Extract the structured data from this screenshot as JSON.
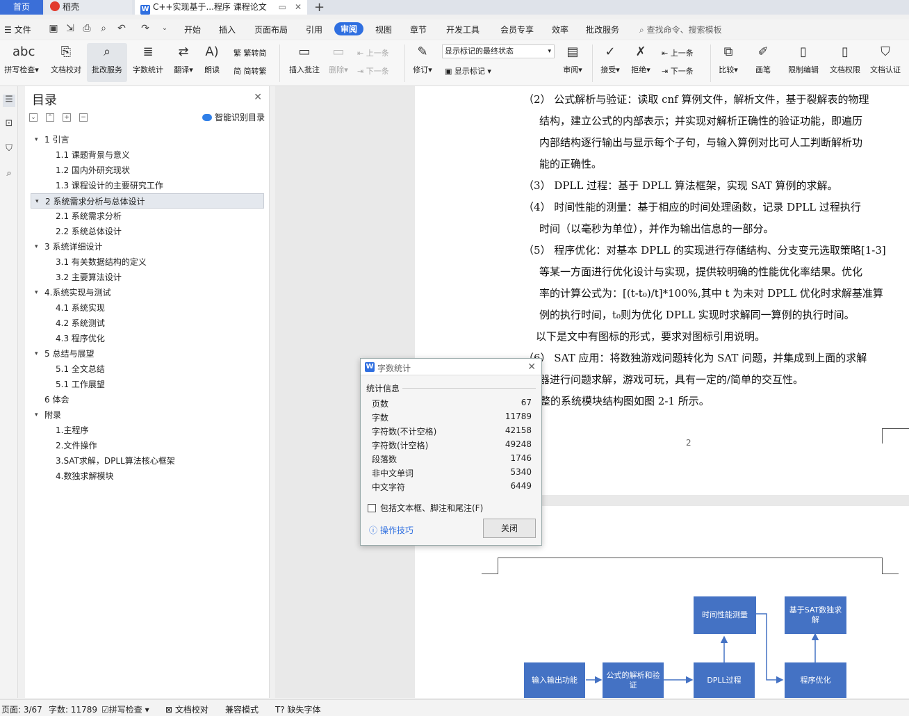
{
  "tabs": {
    "home": "首页",
    "wk": "稻壳",
    "doc": "C++实现基于...程序 课程论文"
  },
  "menu": {
    "file": "文件",
    "items": [
      "开始",
      "插入",
      "页面布局",
      "引用",
      "审阅",
      "视图",
      "章节",
      "开发工具",
      "会员专享",
      "效率",
      "批改服务"
    ],
    "active": "审阅",
    "search": "查找命令、搜索模板"
  },
  "ribbon": {
    "spell": "拼写检查",
    "proof": "文档校对",
    "review_service": "批改服务",
    "word_count": "字数统计",
    "translate": "翻译",
    "read": "朗读",
    "trad": "繁转简",
    "simp": "简转繁",
    "insert_comment": "插入批注",
    "delete": "删除",
    "prev": "上一条",
    "next": "下一条",
    "revise": "修订",
    "markup_state": "显示标记的最终状态",
    "show_markup": "显示标记",
    "review": "审阅",
    "accept": "接受",
    "reject": "拒绝",
    "prev2": "上一条",
    "next2": "下一条",
    "compare": "比较",
    "pen": "画笔",
    "restrict": "限制编辑",
    "perm": "文档权限",
    "auth": "文档认证"
  },
  "toc": {
    "title": "目录",
    "smart": "智能识别目录",
    "items": [
      {
        "text": "1 引言",
        "level": 1,
        "arrow": true
      },
      {
        "text": "1.1  课题背景与意义",
        "level": 2
      },
      {
        "text": "1.2  国内外研究现状",
        "level": 2
      },
      {
        "text": "1.3  课程设计的主要研究工作",
        "level": 2
      },
      {
        "text": "2  系统需求分析与总体设计",
        "level": 1,
        "arrow": true,
        "selected": true
      },
      {
        "text": "2.1    系统需求分析",
        "level": 2
      },
      {
        "text": "2.2  系统总体设计",
        "level": 2
      },
      {
        "text": "3  系统详细设计",
        "level": 1,
        "arrow": true
      },
      {
        "text": "3.1    有关数据结构的定义",
        "level": 2
      },
      {
        "text": "3.2    主要算法设计",
        "level": 2
      },
      {
        "text": "4.系统实现与测试",
        "level": 1,
        "arrow": true
      },
      {
        "text": "4.1  系统实现",
        "level": 2
      },
      {
        "text": "4.2  系统测试",
        "level": 2
      },
      {
        "text": "4.3 程序优化",
        "level": 2
      },
      {
        "text": "5  总结与展望",
        "level": 1,
        "arrow": true
      },
      {
        "text": "5.1  全文总结",
        "level": 2
      },
      {
        "text": "5.1  工作展望",
        "level": 2
      },
      {
        "text": "6 体会",
        "level": 1
      },
      {
        "text": "附录",
        "level": 1,
        "arrow": true
      },
      {
        "text": "1.主程序",
        "level": 2
      },
      {
        "text": "2.文件操作",
        "level": 2
      },
      {
        "text": "3.SAT求解，DPLL算法核心框架",
        "level": 2
      },
      {
        "text": "4.数独求解模块",
        "level": 2
      }
    ]
  },
  "doc": {
    "p2": [
      "（2）   公式解析与验证：读取 cnf 算例文件，解析文件，基于裂解表的物理",
      "结构，建立公式的内部表示；并实现对解析正确性的验证功能，即遍历",
      "内部结构逐行输出与显示每个子句，与输入算例对比可人工判断解析功",
      "能的正确性。"
    ],
    "p3": [
      "（3）   DPLL 过程：基于 DPLL 算法框架，实现 SAT 算例的求解。"
    ],
    "p4": [
      "（4）   时间性能的测量：基于相应的时间处理函数，记录 DPLL 过程执行",
      "时间（以毫秒为单位），并作为输出信息的一部分。"
    ],
    "p5": [
      "（5）   程序优化：对基本 DPLL 的实现进行存储结构、分支变元选取策略[1-3]",
      "等某一方面进行优化设计与实现，提供较明确的性能优化率结果。优化",
      "率的计算公式为：[(t-t₀)/t]*100%,其中 t  为未对 DPLL 优化时求解基准算",
      "例的执行时间，t₀则为优化 DPLL 实现时求解同一算例的执行时间。"
    ],
    "p_note": "以下是文中有图标的形式，要求对图标引用说明。",
    "p6": [
      "（6）   SAT 应用：将数独游戏问题转化为 SAT 问题，并集成到上面的求解",
      "器进行问题求解，游戏可玩，具有一定的/简单的交互性。"
    ],
    "p7": "整的系统模块结构图如图 2-1 所示。",
    "page_number": "2"
  },
  "diagram": {
    "io": "输入输出功能",
    "parse": "公式的解析和验证",
    "dpll": "DPLL过程",
    "time": "时间性能测量",
    "opt": "程序优化",
    "sudoku": "基于SAT数独求解"
  },
  "dialog": {
    "title": "字数统计",
    "section": "统计信息",
    "rows": [
      {
        "label": "页数",
        "value": "67"
      },
      {
        "label": "字数",
        "value": "11789"
      },
      {
        "label": "字符数(不计空格)",
        "value": "42158"
      },
      {
        "label": "字符数(计空格)",
        "value": "49248"
      },
      {
        "label": "段落数",
        "value": "1746"
      },
      {
        "label": "非中文单词",
        "value": "5340"
      },
      {
        "label": "中文字符",
        "value": "6449"
      }
    ],
    "checkbox": "包括文本框、脚注和尾注(F)",
    "tips": "操作技巧",
    "close": "关闭"
  },
  "status": {
    "page": "页面: 3/67",
    "words": "字数: 11789",
    "spell": "拼写检查",
    "proof": "文档校对",
    "compat": "兼容模式",
    "missing_font": "缺失字体"
  },
  "colors": {
    "accent": "#2f6fe0",
    "diagram_box": "#4472c4"
  }
}
